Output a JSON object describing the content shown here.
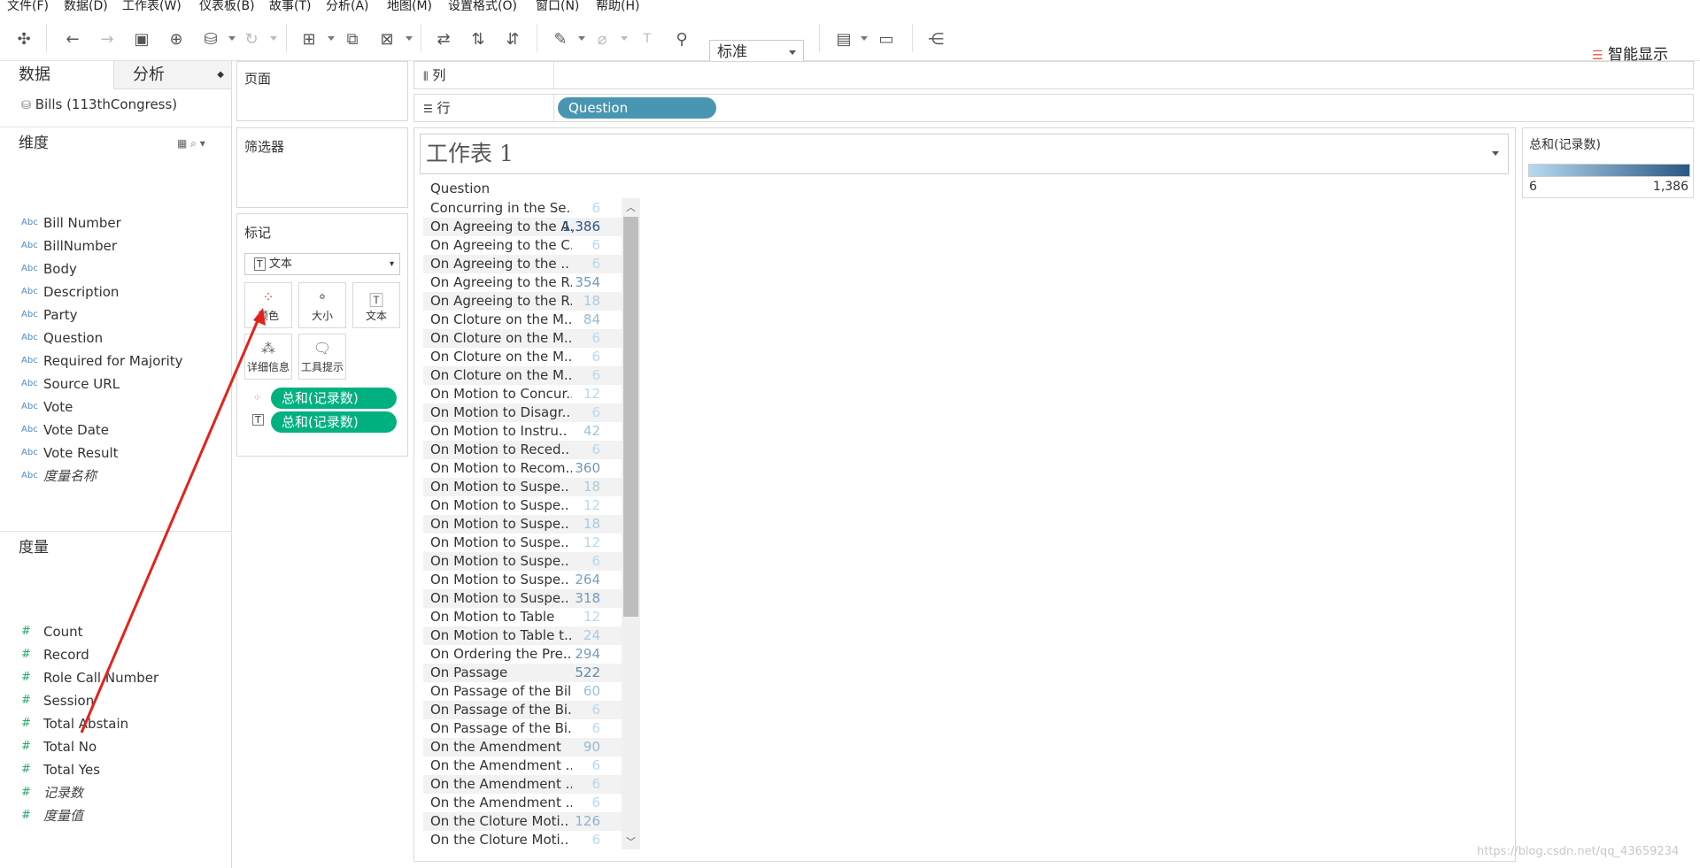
{
  "menu": [
    "文件(F)",
    "数据(D)",
    "工作表(W)",
    "仪表板(B)",
    "故事(T)",
    "分析(A)",
    "地图(M)",
    "设置格式(O)",
    "窗口(N)",
    "帮助(H)"
  ],
  "toolbar": {
    "fit_value": "标准",
    "show_me_label": "智能显示"
  },
  "left_pane": {
    "tab_data": "数据",
    "tab_analytics": "分析",
    "datasource": "Bills (113thCongress)",
    "dimensions_header": "维度",
    "dimensions": [
      {
        "name": "Bill Number",
        "type": "Abc",
        "italic": false
      },
      {
        "name": "BillNumber",
        "type": "Abc",
        "italic": false
      },
      {
        "name": "Body",
        "type": "Abc",
        "italic": false
      },
      {
        "name": "Description",
        "type": "Abc",
        "italic": false
      },
      {
        "name": "Party",
        "type": "Abc",
        "italic": false
      },
      {
        "name": "Question",
        "type": "Abc",
        "italic": false
      },
      {
        "name": "Required for Majority",
        "type": "Abc",
        "italic": false
      },
      {
        "name": "Source URL",
        "type": "Abc",
        "italic": false
      },
      {
        "name": "Vote",
        "type": "Abc",
        "italic": false
      },
      {
        "name": "Vote Date",
        "type": "Abc",
        "italic": false
      },
      {
        "name": "Vote Result",
        "type": "Abc",
        "italic": false
      },
      {
        "name": "度量名称",
        "type": "Abc",
        "italic": true
      }
    ],
    "measures_header": "度量",
    "measures": [
      {
        "name": "Count",
        "italic": false
      },
      {
        "name": "Record",
        "italic": false
      },
      {
        "name": "Role Call Number",
        "italic": false
      },
      {
        "name": "Session",
        "italic": false
      },
      {
        "name": "Total Abstain",
        "italic": false
      },
      {
        "name": "Total No",
        "italic": false
      },
      {
        "name": "Total Yes",
        "italic": false
      },
      {
        "name": "记录数",
        "italic": true
      },
      {
        "name": "度量值",
        "italic": true
      }
    ]
  },
  "cards": {
    "pages": "页面",
    "filters": "筛选器",
    "marks": "标记",
    "mark_type": "文本",
    "mark_buttons": [
      "颜色",
      "大小",
      "文本",
      "详细信息",
      "工具提示"
    ],
    "mark_pills": [
      "总和(记录数)",
      "总和(记录数)"
    ]
  },
  "shelves": {
    "columns_label": "列",
    "rows_label": "行",
    "rows_pill": "Question"
  },
  "view": {
    "sheet_title": "工作表 1",
    "column_header": "Question",
    "rows": [
      {
        "q": "Concurring in the Se..",
        "v": "6",
        "level": 0.0
      },
      {
        "q": "On Agreeing to the A..",
        "v": "1,386",
        "level": 1.0
      },
      {
        "q": "On Agreeing to the C..",
        "v": "6",
        "level": 0.0
      },
      {
        "q": "On Agreeing to the ..",
        "v": "6",
        "level": 0.0
      },
      {
        "q": "On Agreeing to the R..",
        "v": "354",
        "level": 0.25
      },
      {
        "q": "On Agreeing to the R..",
        "v": "18",
        "level": 0.01
      },
      {
        "q": "On Cloture on the M..",
        "v": "84",
        "level": 0.06
      },
      {
        "q": "On Cloture on the M..",
        "v": "6",
        "level": 0.0
      },
      {
        "q": "On Cloture on the M..",
        "v": "6",
        "level": 0.0
      },
      {
        "q": "On Cloture on the M..",
        "v": "6",
        "level": 0.0
      },
      {
        "q": "On Motion to Concur..",
        "v": "12",
        "level": 0.0
      },
      {
        "q": "On Motion to Disagr..",
        "v": "6",
        "level": 0.0
      },
      {
        "q": "On Motion to Instru..",
        "v": "42",
        "level": 0.03
      },
      {
        "q": "On Motion to Reced..",
        "v": "6",
        "level": 0.0
      },
      {
        "q": "On Motion to Recom..",
        "v": "360",
        "level": 0.26
      },
      {
        "q": "On Motion to Suspe..",
        "v": "18",
        "level": 0.01
      },
      {
        "q": "On Motion to Suspe..",
        "v": "12",
        "level": 0.0
      },
      {
        "q": "On Motion to Suspe..",
        "v": "18",
        "level": 0.01
      },
      {
        "q": "On Motion to Suspe..",
        "v": "12",
        "level": 0.0
      },
      {
        "q": "On Motion to Suspe..",
        "v": "6",
        "level": 0.0
      },
      {
        "q": "On Motion to Suspe..",
        "v": "264",
        "level": 0.19
      },
      {
        "q": "On Motion to Suspe..",
        "v": "318",
        "level": 0.23
      },
      {
        "q": "On Motion to Table",
        "v": "12",
        "level": 0.0
      },
      {
        "q": "On Motion to Table t..",
        "v": "24",
        "level": 0.01
      },
      {
        "q": "On Ordering the Pre..",
        "v": "294",
        "level": 0.21
      },
      {
        "q": "On Passage",
        "v": "522",
        "level": 0.38
      },
      {
        "q": "On Passage of the Bill",
        "v": "60",
        "level": 0.04
      },
      {
        "q": "On Passage of the Bi..",
        "v": "6",
        "level": 0.0
      },
      {
        "q": "On Passage of the Bi..",
        "v": "6",
        "level": 0.0
      },
      {
        "q": "On the Amendment",
        "v": "90",
        "level": 0.06
      },
      {
        "q": "On the Amendment ..",
        "v": "6",
        "level": 0.0
      },
      {
        "q": "On the Amendment ..",
        "v": "6",
        "level": 0.0
      },
      {
        "q": "On the Amendment ..",
        "v": "6",
        "level": 0.0
      },
      {
        "q": "On the Cloture Moti..",
        "v": "126",
        "level": 0.09
      },
      {
        "q": "On the Cloture Moti..",
        "v": "6",
        "level": 0.0
      }
    ]
  },
  "legend": {
    "title": "总和(记录数)",
    "min": "6",
    "max": "1,386",
    "color_low": "#b7d9ef",
    "color_high": "#2a5783"
  },
  "watermark": "https://blog.csdn.net/qq_43659234"
}
